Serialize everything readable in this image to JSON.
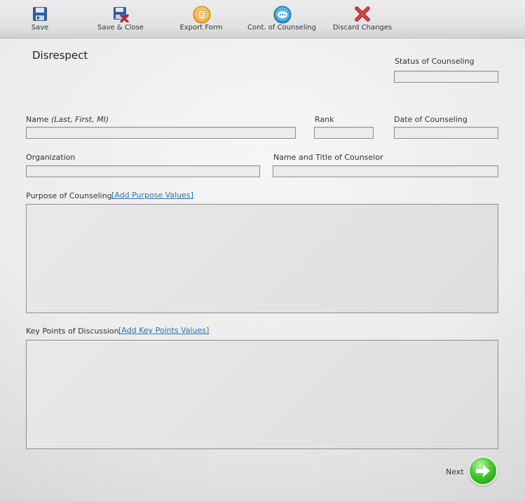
{
  "toolbar": {
    "save": "Save",
    "save_close": "Save & Close",
    "export": "Export Form",
    "cont": "Cont. of Counseling",
    "discard": "Discard Changes"
  },
  "form": {
    "title": "Disrespect",
    "status_label": "Status of Counseling",
    "status_value": "",
    "name_label": "Name",
    "name_hint": "(Last, First, MI)",
    "name_value": "",
    "rank_label": "Rank",
    "rank_value": "",
    "date_label": "Date of Counseling",
    "date_value": "",
    "org_label": "Organization",
    "org_value": "",
    "counselor_label": "Name and Title of Counselor",
    "counselor_value": "",
    "purpose_label": "Purpose of Counseling",
    "purpose_link": "[Add Purpose Values]",
    "purpose_value": "",
    "keypoints_label": "Key Points of Discussion",
    "keypoints_link": "[Add Key Points Values]",
    "keypoints_value": "",
    "next_label": "Next"
  },
  "colors": {
    "link": "#2a6fb5",
    "next_green": "#45c733"
  },
  "icons": {
    "save": "floppy-disk-icon",
    "save_close": "floppy-disk-close-icon",
    "export": "export-form-icon",
    "cont": "speech-bubble-icon",
    "discard": "red-x-icon",
    "next": "arrow-right-icon"
  }
}
